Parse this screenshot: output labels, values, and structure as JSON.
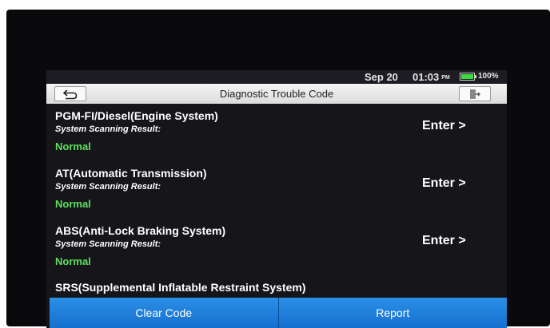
{
  "status_bar": {
    "date": "Sep 20",
    "time": "01:03",
    "ampm": "PM",
    "battery_percent": "100%",
    "battery_color": "#3ddc3d"
  },
  "header": {
    "title": "Diagnostic Trouble Code",
    "back_icon": "back-arrow-icon",
    "exit_icon": "exit-door-icon"
  },
  "systems": [
    {
      "name": "PGM-FI/Diesel(Engine System)",
      "result_label": "System Scanning Result:",
      "result": "Normal",
      "action": "Enter >"
    },
    {
      "name": "AT(Automatic Transmission)",
      "result_label": "System Scanning Result:",
      "result": "Normal",
      "action": "Enter >"
    },
    {
      "name": "ABS(Anti-Lock Braking System)",
      "result_label": "System Scanning Result:",
      "result": "Normal",
      "action": "Enter >"
    },
    {
      "name": "SRS(Supplemental Inflatable Restraint System)"
    }
  ],
  "footer": {
    "clear_label": "Clear Code",
    "report_label": "Report"
  },
  "colors": {
    "normal_status": "#5ee05e",
    "button_blue": "#1f80dc"
  }
}
